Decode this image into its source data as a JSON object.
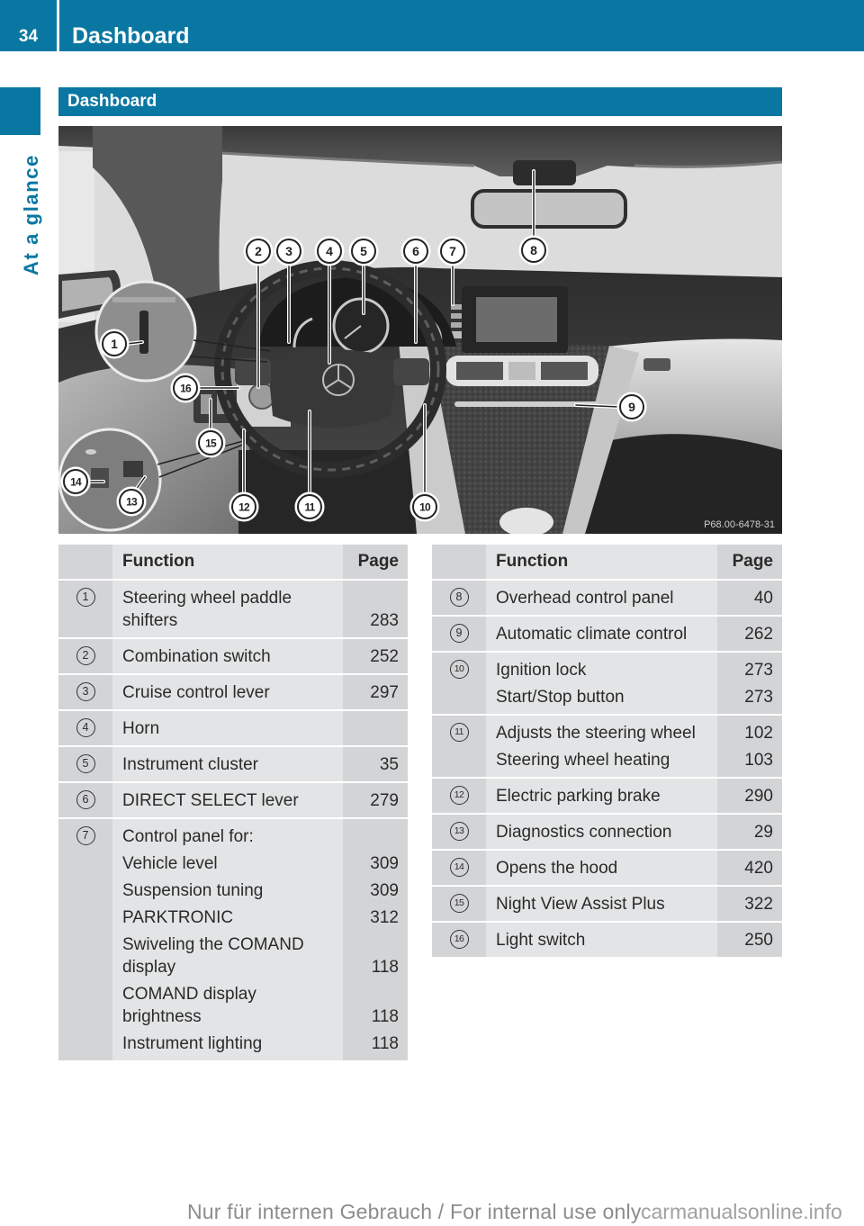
{
  "header": {
    "page_number": "34",
    "title": "Dashboard"
  },
  "sidebar": {
    "chapter": "At a glance"
  },
  "section": {
    "title": "Dashboard"
  },
  "figure": {
    "callouts": [
      "1",
      "2",
      "3",
      "4",
      "5",
      "6",
      "7",
      "8",
      "9",
      "10",
      "11",
      "12",
      "13",
      "14",
      "15",
      "16"
    ],
    "image_code": "P68.00-6478-31"
  },
  "tables": [
    {
      "columns": {
        "number": "",
        "function": "Function",
        "page": "Page"
      },
      "rows": [
        {
          "number": "1",
          "entries": [
            {
              "lines": [
                "Steering wheel paddle",
                "shifters"
              ],
              "page": "283"
            }
          ]
        },
        {
          "number": "2",
          "entries": [
            {
              "lines": [
                "Combination switch"
              ],
              "page": "252"
            }
          ]
        },
        {
          "number": "3",
          "entries": [
            {
              "lines": [
                "Cruise control lever"
              ],
              "page": "297"
            }
          ]
        },
        {
          "number": "4",
          "entries": [
            {
              "lines": [
                "Horn"
              ]
            }
          ]
        },
        {
          "number": "5",
          "entries": [
            {
              "lines": [
                "Instrument cluster"
              ],
              "page": "35"
            }
          ]
        },
        {
          "number": "6",
          "entries": [
            {
              "lines": [
                "DIRECT SELECT lever"
              ],
              "page": "279"
            }
          ]
        },
        {
          "number": "7",
          "entries": [
            {
              "lines": [
                "Control panel for:"
              ]
            },
            {
              "lines": [
                "Vehicle level"
              ],
              "page": "309"
            },
            {
              "lines": [
                "Suspension tuning"
              ],
              "page": "309"
            },
            {
              "lines": [
                "PARKTRONIC"
              ],
              "page": "312"
            },
            {
              "lines": [
                "Swiveling the COMAND",
                "display"
              ],
              "page": "118"
            },
            {
              "lines": [
                "COMAND display",
                "brightness"
              ],
              "page": "118"
            },
            {
              "lines": [
                "Instrument lighting"
              ],
              "page": "118"
            }
          ]
        }
      ]
    },
    {
      "columns": {
        "number": "",
        "function": "Function",
        "page": "Page"
      },
      "rows": [
        {
          "number": "8",
          "entries": [
            {
              "lines": [
                "Overhead control panel"
              ],
              "page": "40"
            }
          ]
        },
        {
          "number": "9",
          "entries": [
            {
              "lines": [
                "Automatic climate control"
              ],
              "page": "262"
            }
          ]
        },
        {
          "number": "10",
          "entries": [
            {
              "lines": [
                "Ignition lock"
              ],
              "page": "273"
            },
            {
              "lines": [
                "Start/Stop button"
              ],
              "page": "273"
            }
          ]
        },
        {
          "number": "11",
          "entries": [
            {
              "lines": [
                "Adjusts the steering wheel"
              ],
              "page": "102"
            },
            {
              "lines": [
                "Steering wheel heating"
              ],
              "page": "103"
            }
          ]
        },
        {
          "number": "12",
          "entries": [
            {
              "lines": [
                "Electric parking brake"
              ],
              "page": "290"
            }
          ]
        },
        {
          "number": "13",
          "entries": [
            {
              "lines": [
                "Diagnostics connection"
              ],
              "page": "29"
            }
          ]
        },
        {
          "number": "14",
          "entries": [
            {
              "lines": [
                "Opens the hood"
              ],
              "page": "420"
            }
          ]
        },
        {
          "number": "15",
          "entries": [
            {
              "lines": [
                "Night View Assist Plus"
              ],
              "page": "322"
            }
          ]
        },
        {
          "number": "16",
          "entries": [
            {
              "lines": [
                "Light switch"
              ],
              "page": "250"
            }
          ]
        }
      ]
    }
  ],
  "footer": {
    "notice": "Nur für internen Gebrauch / For internal use only",
    "watermark": "carmanualsonline.info"
  }
}
